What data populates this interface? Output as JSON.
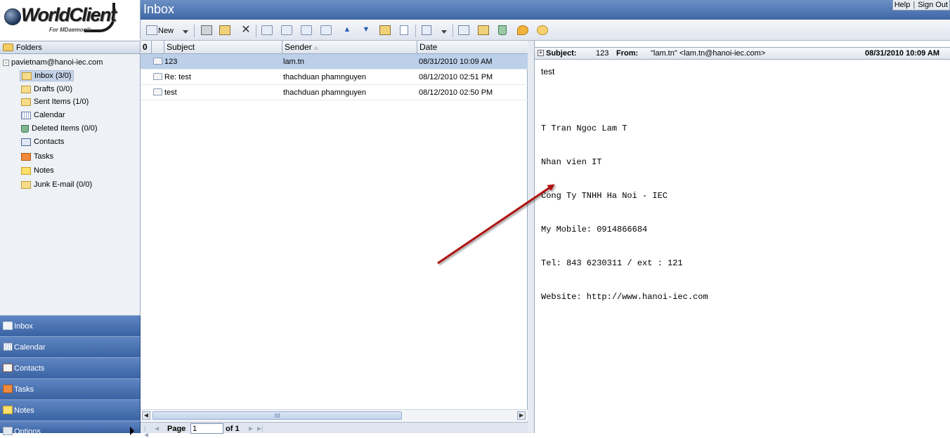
{
  "logo": {
    "brand": "WorldClient",
    "sub": "For MDaemon®"
  },
  "window": {
    "title": "Inbox"
  },
  "top_links": {
    "help": "Help",
    "separator": "|",
    "signout": "Sign Out"
  },
  "toolbar": {
    "new_label": "New"
  },
  "folders": {
    "header": "Folders",
    "account": "pavietnam@hanoi-iec.com",
    "items": [
      {
        "label": "Inbox (3/0)",
        "icon": "envelope-icon"
      },
      {
        "label": "Drafts (0/0)",
        "icon": "envelope-icon"
      },
      {
        "label": "Sent Items (1/0)",
        "icon": "envelope-icon"
      },
      {
        "label": "Calendar",
        "icon": "calendar-icon"
      },
      {
        "label": "Deleted Items (0/0)",
        "icon": "trash-icon"
      },
      {
        "label": "Contacts",
        "icon": "contacts-icon"
      },
      {
        "label": "Tasks",
        "icon": "tasks-icon"
      },
      {
        "label": "Notes",
        "icon": "notes-icon"
      },
      {
        "label": "Junk E-mail (0/0)",
        "icon": "envelope-icon"
      }
    ]
  },
  "nav": {
    "inbox": "Inbox",
    "calendar": "Calendar",
    "contacts": "Contacts",
    "tasks": "Tasks",
    "notes": "Notes",
    "options": "Options"
  },
  "list": {
    "columns": {
      "attach": "",
      "subject": "Subject",
      "sender": "Sender",
      "date": "Date"
    },
    "rows": [
      {
        "subject": "123",
        "sender": "lam.tn",
        "date": "08/31/2010 10:09 AM"
      },
      {
        "subject": "Re: test",
        "sender": "thachduan phamnguyen",
        "date": "08/12/2010 02:51 PM"
      },
      {
        "subject": "test",
        "sender": "thachduan phamnguyen",
        "date": "08/12/2010 02:50 PM"
      }
    ]
  },
  "pager": {
    "page_label": "Page",
    "page_value": "1",
    "of_label": "of 1"
  },
  "preview": {
    "subject_label": "Subject:",
    "subject": "123",
    "from_label": "From:",
    "from": "\"lam.tn\" <lam.tn@hanoi-iec.com>",
    "date": "08/31/2010 10:09 AM",
    "body": "test",
    "signature": [
      "T Tran Ngoc Lam T",
      "Nhan vien IT",
      "Cong Ty TNHH Ha Noi - IEC",
      "My Mobile: 0914866684",
      "Tel: 843 6230311 / ext : 121",
      "Website: http://www.hanoi-iec.com"
    ]
  },
  "colors": {
    "accent": "#3f68a6",
    "selection": "#bcd0ea",
    "annotation_arrow": "#b01010"
  }
}
